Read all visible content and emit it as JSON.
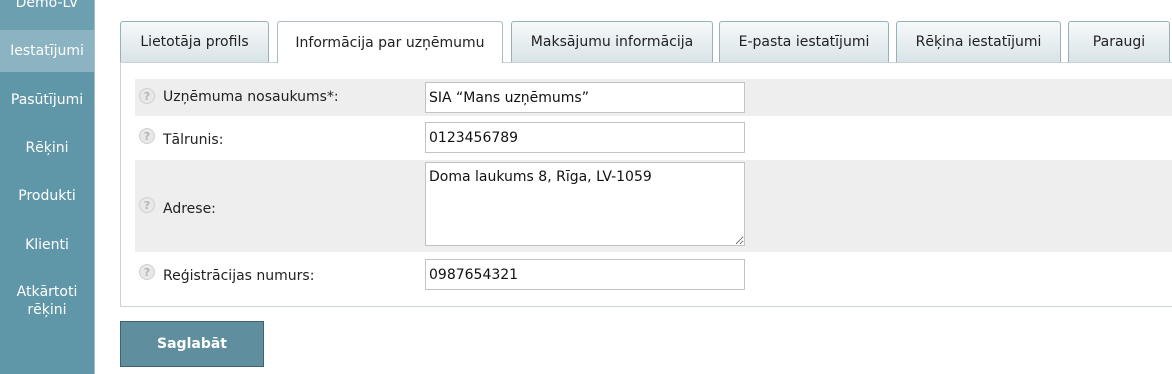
{
  "sidebar": {
    "brand": "Demo-LV",
    "items": [
      {
        "label": "Iestatījumi"
      },
      {
        "label": "Pasūtījumi"
      },
      {
        "label": "Rēķini"
      },
      {
        "label": "Produkti"
      },
      {
        "label": "Klienti"
      },
      {
        "label": "Atkārtoti rēķini"
      }
    ]
  },
  "tabs": [
    {
      "label": "Lietotāja profils"
    },
    {
      "label": "Informācija par uzņēmumu"
    },
    {
      "label": "Maksājumu informācija"
    },
    {
      "label": "E-pasta iestatījumi"
    },
    {
      "label": "Rēķina iestatījumi"
    },
    {
      "label": "Paraugi"
    }
  ],
  "form": {
    "company_name": {
      "label": "Uzņēmuma nosaukums*:",
      "value": "SIA “Mans uzņēmums”"
    },
    "phone": {
      "label": "Tālrunis:",
      "value": "0123456789"
    },
    "address": {
      "label": "Adrese:",
      "value": "Doma laukums 8, Rīga, LV-1059"
    },
    "registration": {
      "label": "Reģistrācijas numurs:",
      "value": "0987654321"
    }
  },
  "help_glyph": "?",
  "save_label": "Saglabāt"
}
